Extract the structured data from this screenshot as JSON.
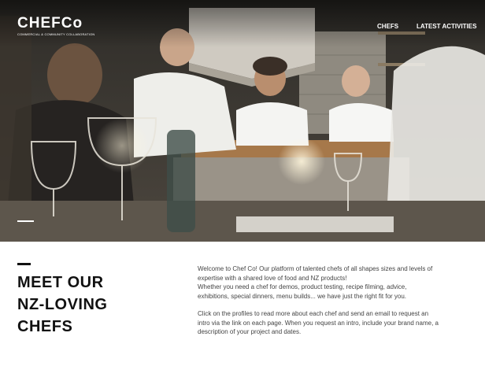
{
  "header": {
    "logo_text": "CHEFCo",
    "logo_tagline": "COMMERCIAL & COMMUNITY COLLABORATION",
    "nav": [
      {
        "label": "CHEFS"
      },
      {
        "label": "LATEST ACTIVITIES"
      }
    ]
  },
  "hero": {
    "image_description": "Chefs in white jackets at a restaurant kitchen pass with diners and wine glasses in the foreground"
  },
  "main": {
    "heading_lines": [
      "MEET OUR",
      "NZ-LOVING",
      "CHEFS"
    ],
    "intro_lines": [
      "Welcome to Chef Co! Our platform of talented chefs of all shapes sizes and levels of",
      "expertise with a shared love of food and NZ products!",
      "Whether you need a chef for demos, product testing, recipe filming, advice,",
      "exhibitions, special dinners, menu builds... we have just the right fit for you."
    ],
    "cta_lines": [
      "Click on the profiles to read more about each chef and send an email to request an",
      "intro via the link on each page. When you request an intro, include your brand name, a",
      "description of your project and dates."
    ]
  },
  "colors": {
    "heading": "#111111",
    "body_text": "#444444",
    "nav_text": "#ffffff"
  }
}
